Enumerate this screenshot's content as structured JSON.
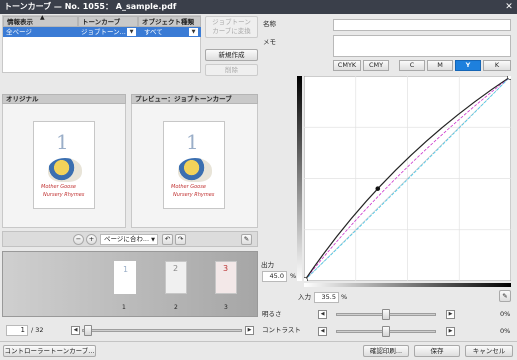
{
  "window": {
    "title": "トーンカーブ — No. 1055： A_sample.pdf",
    "close_icon": "close-icon"
  },
  "table": {
    "headers": [
      "情報表示",
      "トーンカーブ",
      "オブジェクト種類"
    ],
    "row": {
      "info": "全ページ",
      "curve": "ジョブトーン...",
      "object": "すべて"
    }
  },
  "side_buttons": {
    "convert": "ジョブトーンカーブに変換",
    "new": "新規作成",
    "delete": "削除"
  },
  "preview": {
    "original_label": "オリジナル",
    "preview_label": "プレビュー：ジョブトーンカーブ",
    "page_number": "1",
    "thumb_title": "Mother Goose",
    "thumb_subtitle": "Nursery Rhymes"
  },
  "toolbar": {
    "fit_value": "ページに合わ..."
  },
  "thumbs": {
    "pages": [
      "1",
      "2",
      "3"
    ]
  },
  "pager": {
    "current": "1",
    "total": "/ 32"
  },
  "right": {
    "name_label": "名称",
    "memo_label": "メモ",
    "name_value": "",
    "memo_value": "",
    "channels": [
      "CMYK",
      "CMY",
      "C",
      "M",
      "Y",
      "K"
    ],
    "active_channel": "Y",
    "colors": {
      "accent": "#1e80dd",
      "black_curve": "#000000",
      "magenta": "#cc33cc",
      "cyan": "#44ccee"
    }
  },
  "curve": {
    "output_label": "出力",
    "output_value": "45.0",
    "input_label": "入力",
    "input_value": "35.5",
    "percent": "%",
    "point": {
      "input": 35.5,
      "output": 45.0
    }
  },
  "sliders": {
    "brightness_label": "明るさ",
    "brightness_value": "0%",
    "contrast_label": "コントラスト",
    "contrast_value": "0%"
  },
  "footer": {
    "controller": "コントローラートーンカーブ...",
    "print": "確認印刷...",
    "save": "保存",
    "cancel": "キャンセル"
  }
}
